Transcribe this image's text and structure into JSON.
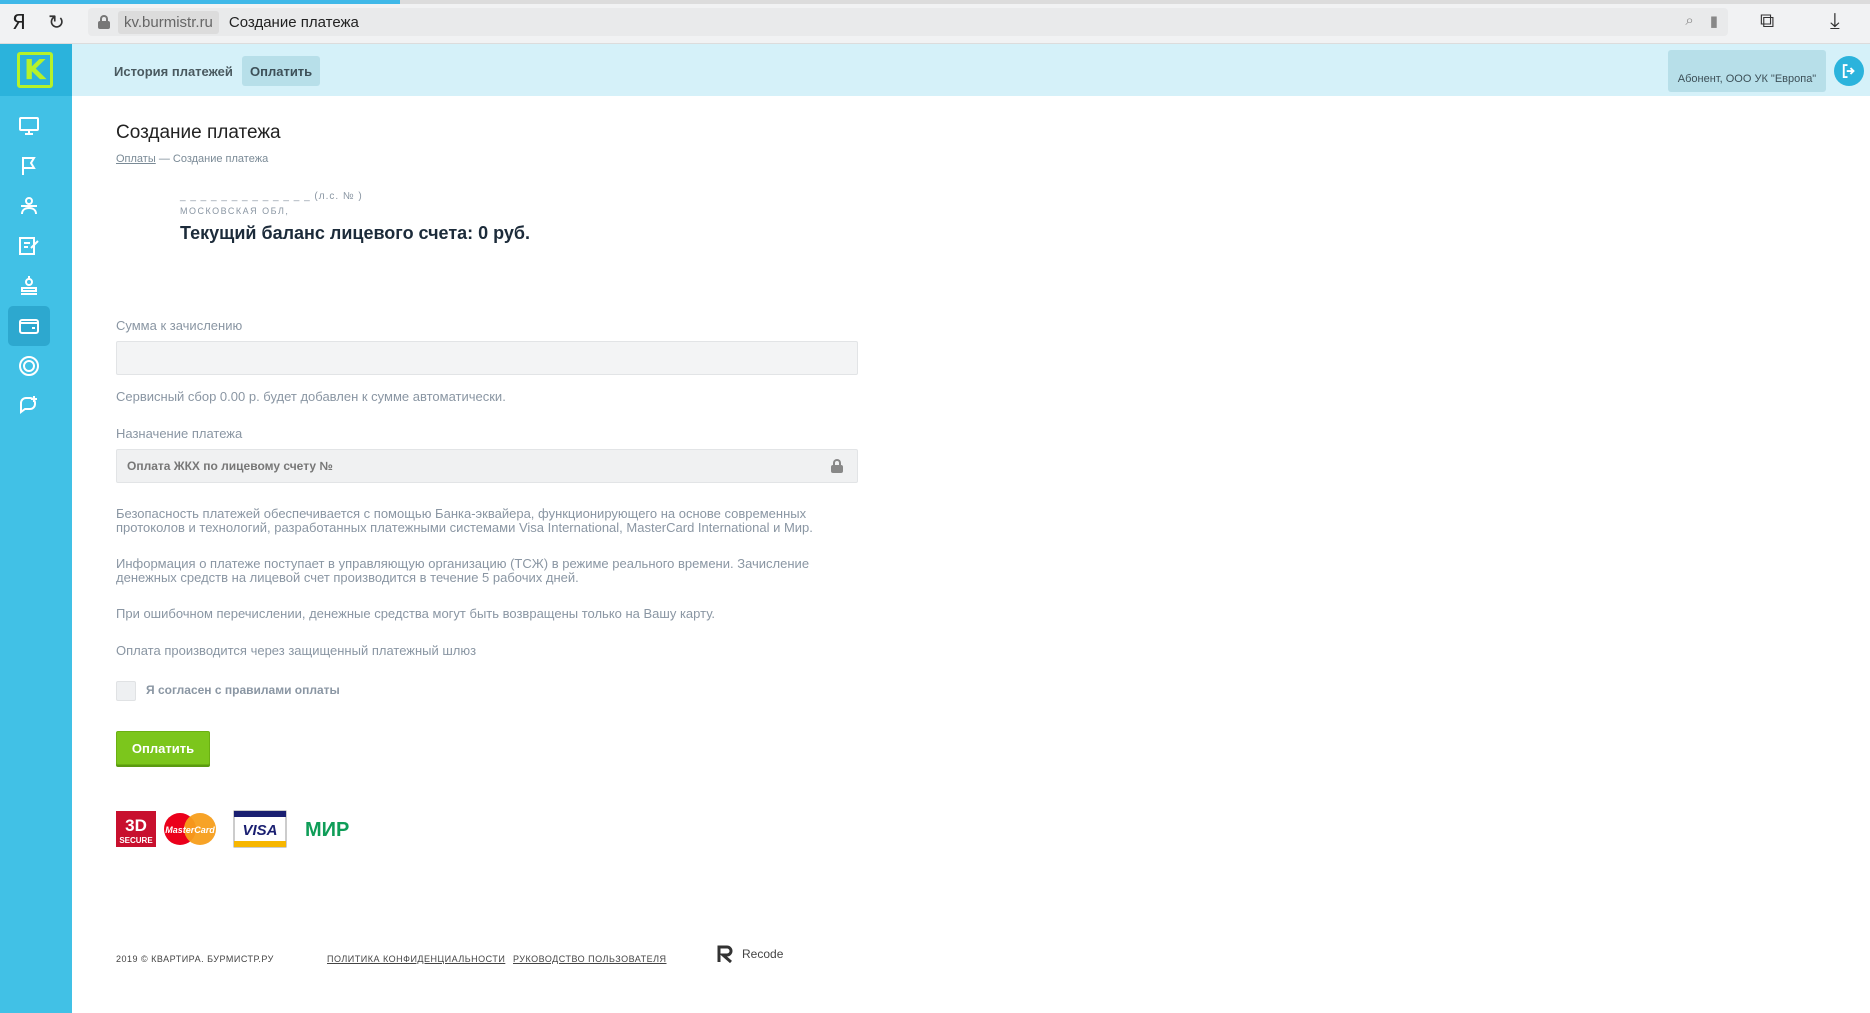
{
  "browser": {
    "logo": "Я",
    "host": "kv.burmistr.ru",
    "title": "Создание платежа"
  },
  "sidebar": {
    "logo_letter": "K",
    "items": [
      {
        "icon": "monitor-icon"
      },
      {
        "icon": "flag-icon"
      },
      {
        "icon": "users-icon"
      },
      {
        "icon": "edit-icon"
      },
      {
        "icon": "meter-icon"
      },
      {
        "icon": "wallet-icon",
        "active": true
      },
      {
        "icon": "coin-icon"
      },
      {
        "icon": "chat-add-icon"
      }
    ]
  },
  "topbar": {
    "tabs": [
      {
        "label": "История платежей",
        "active": false
      },
      {
        "label": "Оплатить",
        "active": true
      }
    ],
    "abonent": "Абонент, ООО УК \"Европа\""
  },
  "page": {
    "title": "Создание платежа",
    "breadcrumb": {
      "root": "Оплаты",
      "sep": "—",
      "current": "Создание платежа"
    }
  },
  "account": {
    "address_line": "_ _ _ _ _ _ _ _ _ _ _ _ _ (л.с. №         )",
    "region": "МОСКОВСКАЯ ОБЛ,",
    "balance": "Текущий баланс лицевого счета: 0 руб."
  },
  "form": {
    "amount_label": "Сумма к зачислению",
    "amount_value": "",
    "fee_note": "Сервисный сбор 0.00 р. будет добавлен к сумме автоматически.",
    "purpose_label": "Назначение платежа",
    "purpose_value": "Оплата ЖКХ по лицевому счету №",
    "info": [
      "Безопасность платежей обеспечивается с помощью Банка-эквайера, функционирующего на основе современных протоколов и технологий, разработанных платежными системами Visa International, MasterCard International и Мир.",
      "Информация о платеже поступает в управляющую организацию (ТСЖ) в режиме реального времени. Зачисление денежных средств на лицевой счет производится в течение 5 рабочих дней.",
      "При ошибочном перечислении, денежные средства могут быть возвращены только на Вашу карту.",
      "Оплата производится через защищенный платежный шлюз"
    ],
    "agree_label": "Я согласен с правилами оплаты",
    "agree_checked": false,
    "pay_button": "Оплатить"
  },
  "payment_logos": {
    "secure_top": "3D",
    "secure_bottom": "SECURE",
    "mastercard": "MasterCard",
    "visa": "VISA",
    "mir": "МИР"
  },
  "footer": {
    "copyright": "2019 © КВАРТИРА. БУРМИСТР.РУ",
    "privacy": "ПОЛИТИКА КОНФИДЕНЦИАЛЬНОСТИ",
    "manual": "РУКОВОДСТВО ПОЛЬЗОВАТЕЛЯ",
    "brand": "Recode"
  },
  "colors": {
    "sidebar": "#41c1e6",
    "topbar": "#d5f1f9",
    "accent_green": "#7cc61c",
    "logo_green": "#b6f22a"
  }
}
